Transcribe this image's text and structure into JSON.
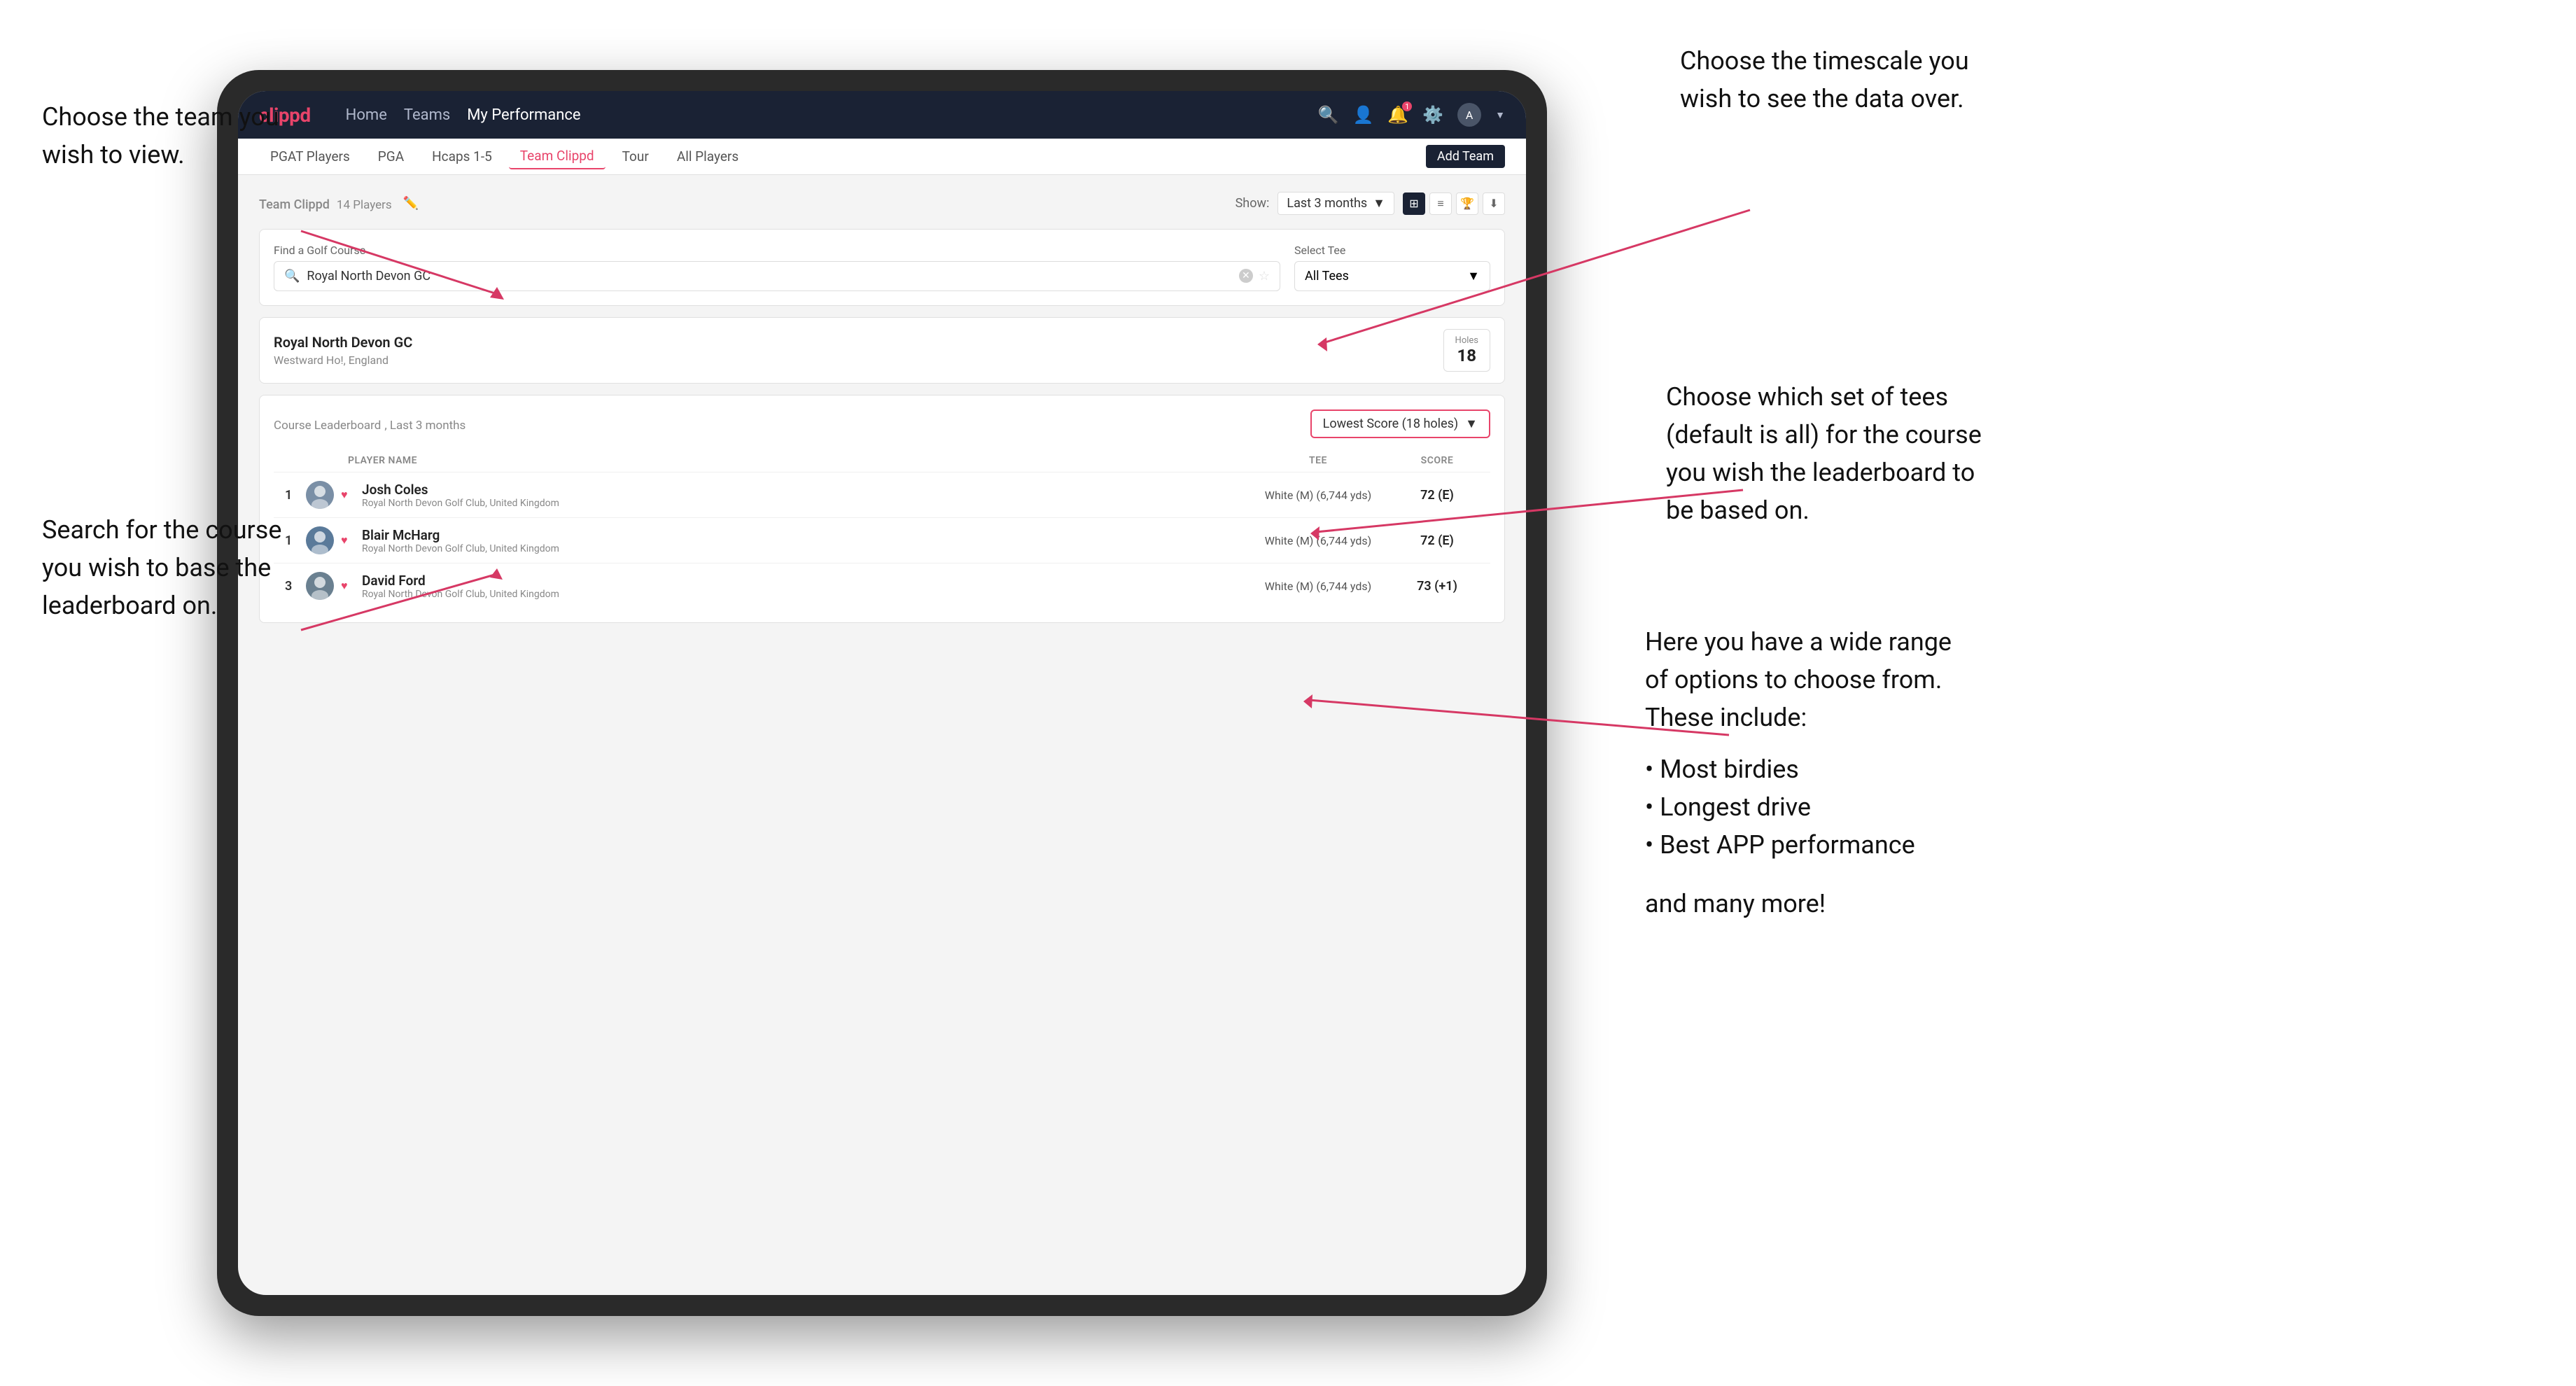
{
  "app": {
    "logo": "clippd",
    "navbar": {
      "links": [
        "Home",
        "Teams",
        "My Performance"
      ],
      "active_link": "My Performance"
    },
    "subnav": {
      "items": [
        "PGAT Players",
        "PGA",
        "Hcaps 1-5",
        "Team Clippd",
        "Tour",
        "All Players"
      ],
      "active_item": "Team Clippd",
      "add_team_label": "Add Team"
    }
  },
  "team_section": {
    "team_title": "Team Clippd",
    "player_count": "14 Players",
    "show_label": "Show:",
    "time_period": "Last 3 months",
    "view_modes": [
      "grid",
      "list",
      "trophy",
      "download"
    ]
  },
  "course_search": {
    "find_label": "Find a Golf Course",
    "search_value": "Royal North Devon GC",
    "select_tee_label": "Select Tee",
    "tee_value": "All Tees"
  },
  "course_result": {
    "name": "Royal North Devon GC",
    "location": "Westward Ho!, England",
    "holes_label": "Holes",
    "holes_value": "18"
  },
  "leaderboard": {
    "title": "Course Leaderboard",
    "period": "Last 3 months",
    "score_type": "Lowest Score (18 holes)",
    "columns": {
      "player": "PLAYER NAME",
      "tee": "TEE",
      "score": "SCORE"
    },
    "players": [
      {
        "rank": "1",
        "name": "Josh Coles",
        "club": "Royal North Devon Golf Club, United Kingdom",
        "tee": "White (M) (6,744 yds)",
        "score": "72 (E)"
      },
      {
        "rank": "1",
        "name": "Blair McHarg",
        "club": "Royal North Devon Golf Club, United Kingdom",
        "tee": "White (M) (6,744 yds)",
        "score": "72 (E)"
      },
      {
        "rank": "3",
        "name": "David Ford",
        "club": "Royal North Devon Golf Club, United Kingdom",
        "tee": "White (M) (6,744 yds)",
        "score": "73 (+1)"
      }
    ]
  },
  "annotations": {
    "top_left_title": "Choose the team you\nwish to view.",
    "left_middle_title": "Search for the course\nyou wish to base the\nleaderboard on.",
    "top_right_title": "Choose the timescale you\nwish to see the data over.",
    "right_middle_title": "Choose which set of tees\n(default is all) for the course\nyou wish the leaderboard to\nbe based on.",
    "right_bottom_title": "Here you have a wide range\nof options to choose from.\nThese include:",
    "options": [
      "Most birdies",
      "Longest drive",
      "Best APP performance"
    ],
    "and_more": "and many more!"
  }
}
